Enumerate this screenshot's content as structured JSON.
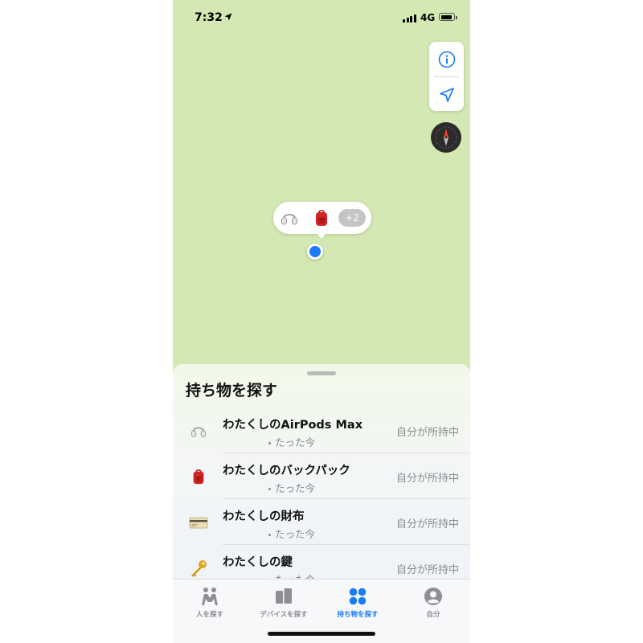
{
  "status_bar": {
    "time": "7:32",
    "network": "4G"
  },
  "map": {
    "controls": [
      {
        "name": "info-button",
        "icon": "info-icon"
      },
      {
        "name": "location-button",
        "icon": "location-arrow-icon"
      }
    ],
    "compass_icon": "compass-icon",
    "bubble": {
      "icons": [
        "airpods-max-icon",
        "backpack-icon"
      ],
      "more_count": "+2"
    }
  },
  "sheet": {
    "title": "持ち物を探す",
    "items": [
      {
        "name": "わたくしのAirPods Max",
        "time": "たった今",
        "status": "自分が所持中",
        "icon": "airpods-max-icon"
      },
      {
        "name": "わたくしのバックパック",
        "time": "たった今",
        "status": "自分が所持中",
        "icon": "backpack-icon"
      },
      {
        "name": "わたくしの財布",
        "time": "たった今",
        "status": "自分が所持中",
        "icon": "wallet-icon"
      },
      {
        "name": "わたくしの鍵",
        "time": "たった今",
        "status": "自分が所持中",
        "icon": "key-icon"
      }
    ]
  },
  "tabs": [
    {
      "label": "人を探す",
      "icon": "people-icon",
      "active": false
    },
    {
      "label": "デバイスを探す",
      "icon": "devices-icon",
      "active": false
    },
    {
      "label": "持ち物を探す",
      "icon": "items-icon",
      "active": true
    },
    {
      "label": "自分",
      "icon": "me-icon",
      "active": false
    }
  ],
  "colors": {
    "accent": "#1a7cf5",
    "map": "#d3e8b2",
    "secondary_text": "#8a8a8e"
  }
}
